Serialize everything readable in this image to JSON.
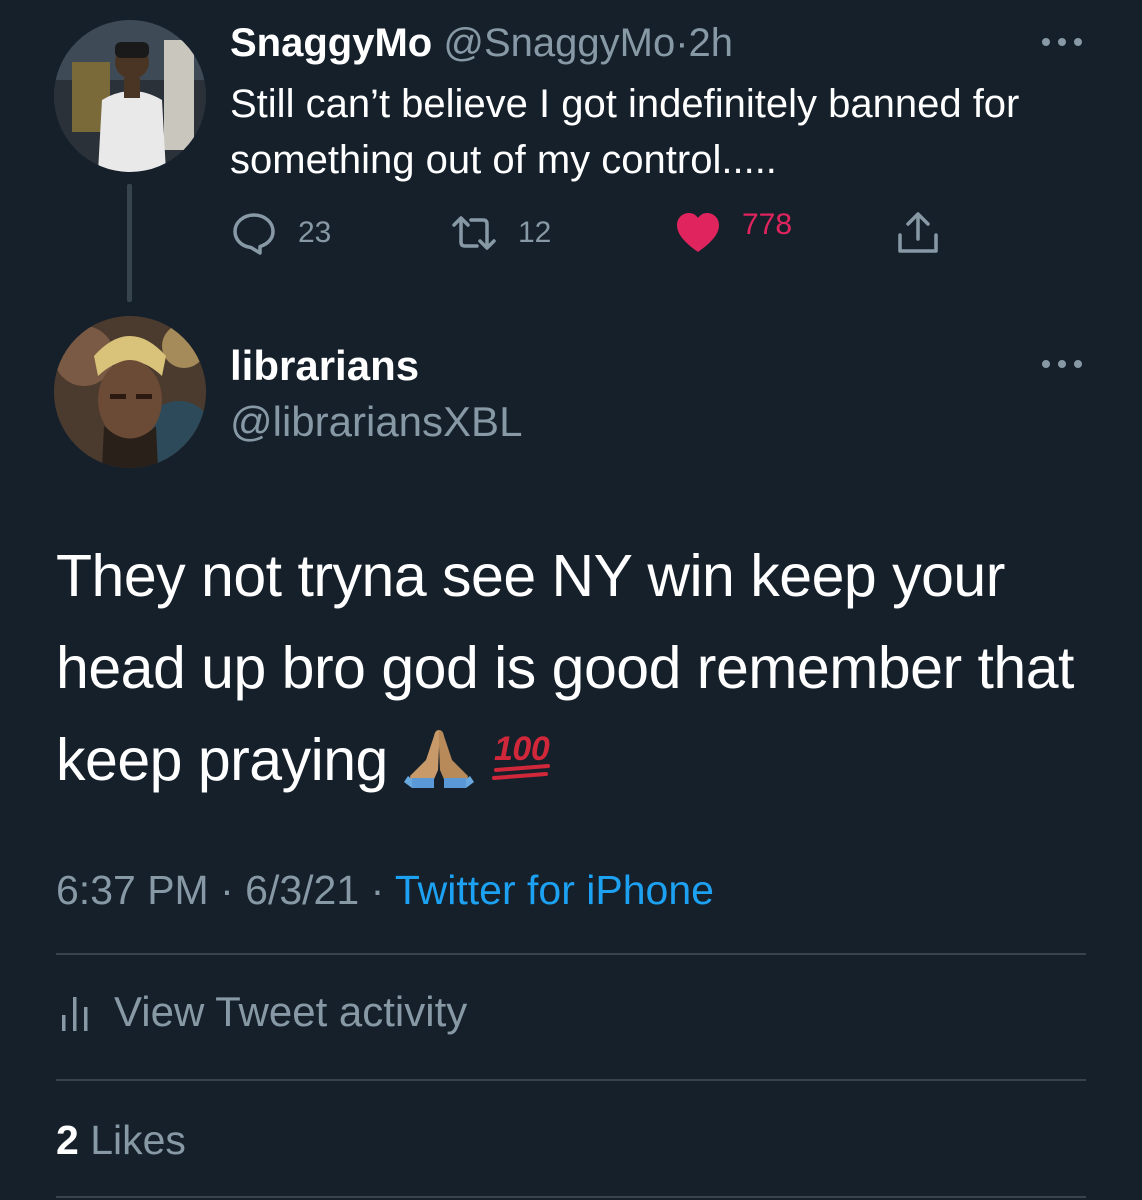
{
  "parent_tweet": {
    "display_name": "SnaggyMo",
    "handle": "@SnaggyMo",
    "separator": "·",
    "time": "2h",
    "text": "Still can’t believe I got indefinitely banned for something out of my control.....",
    "reply_count": "23",
    "retweet_count": "12",
    "like_count": "778",
    "liked": true
  },
  "main_tweet": {
    "display_name": "librarians",
    "handle": "@librariansXBL",
    "text": "They not tryna see NY win keep your head up bro god is good remember that keep praying",
    "emojis": [
      "folded-hands",
      "hundred-points"
    ],
    "time": "6:37 PM",
    "separator": "·",
    "date": "6/3/21",
    "source": "Twitter for iPhone",
    "activity_label": "View Tweet activity",
    "likes_count": "2",
    "likes_label": "Likes"
  },
  "colors": {
    "background": "#15202b",
    "text_primary": "#ffffff",
    "text_secondary": "#8899a6",
    "link": "#1da1f2",
    "like": "#e0245e",
    "divider": "#38444d"
  }
}
